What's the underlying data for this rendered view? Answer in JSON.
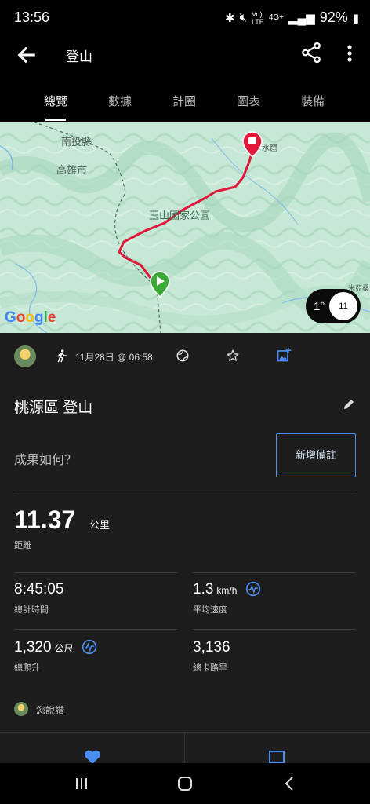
{
  "status": {
    "time": "13:56",
    "network": "4G+",
    "battery": "92%"
  },
  "appbar": {
    "title": "登山"
  },
  "tabs": [
    {
      "label": "總覽",
      "active": true
    },
    {
      "label": "數據",
      "active": false
    },
    {
      "label": "計圈",
      "active": false
    },
    {
      "label": "圖表",
      "active": false
    },
    {
      "label": "裝備",
      "active": false
    }
  ],
  "map": {
    "labels": {
      "nantou": "南投縣",
      "kaohsiung": "高雄市",
      "park": "玉山國家公園",
      "end_place": "水窟",
      "corner": "米亞桑",
      "google": "Google"
    },
    "compass": {
      "degrees": "1°",
      "zoom": "11"
    }
  },
  "activity": {
    "date": "11月28日 @ 06:58",
    "name": "桃源區 登山",
    "prompt": "成果如何？",
    "add_note": "新增備註"
  },
  "stats": {
    "distance": {
      "value": "11.37",
      "unit": "公里",
      "label": "距離"
    },
    "total_time": {
      "value": "8:45:05",
      "label": "總計時間"
    },
    "avg_speed": {
      "value": "1.3",
      "unit": "km/h",
      "label": "平均速度"
    },
    "ascent": {
      "value": "1,320",
      "unit": "公尺",
      "label": "總爬升"
    },
    "calories": {
      "value": "3,136",
      "label": "總卡路里"
    }
  },
  "comment": {
    "placeholder": "您說讚"
  },
  "colors": {
    "accent": "#4a8ef0",
    "route": "#e0183a",
    "start": "#3aa935",
    "map_bg": "#c6e7d6"
  }
}
